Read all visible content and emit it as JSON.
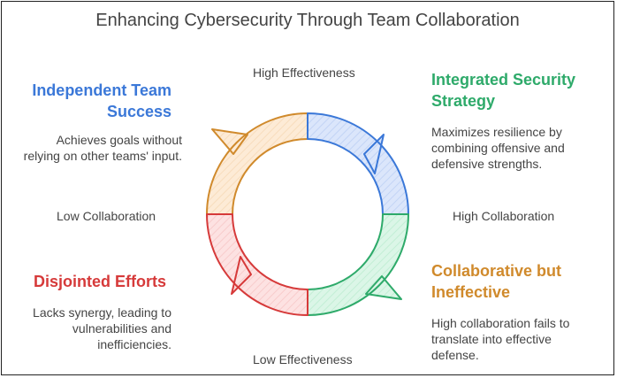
{
  "title": "Enhancing Cybersecurity Through Team Collaboration",
  "axes": {
    "top": "High Effectiveness",
    "bottom": "Low Effectiveness",
    "left": "Low Collaboration",
    "right": "High Collaboration"
  },
  "quadrants": {
    "top_left": {
      "title_line1": "Independent Team",
      "title_line2": "Success",
      "desc": [
        "Achieves goals without",
        "relying on other teams' input."
      ],
      "color": "#3b78d8"
    },
    "top_right": {
      "title_line1": "Integrated Security",
      "title_line2": "Strategy",
      "desc": [
        "Maximizes resilience by",
        "combining offensive and",
        "defensive strengths."
      ],
      "color": "#2eaa6a"
    },
    "bottom_left": {
      "title_line1": "Disjointed Efforts",
      "desc": [
        "Lacks synergy, leading to",
        "vulnerabilities and",
        "inefficiencies."
      ],
      "color": "#d63a3a"
    },
    "bottom_right": {
      "title_line1": "Collaborative but",
      "title_line2": "Ineffective",
      "desc": [
        "High collaboration fails to",
        "translate into effective",
        "defense."
      ],
      "color": "#d08a2c"
    }
  },
  "cycle_colors": {
    "top_left_fill": "#fde9d2",
    "top_left_stroke": "#d08a2c",
    "top_right_fill": "#dbe6fb",
    "top_right_stroke": "#3b78d8",
    "bottom_right_fill": "#d9f5e6",
    "bottom_right_stroke": "#2eaa6a",
    "bottom_left_fill": "#fde0e0",
    "bottom_left_stroke": "#d63a3a"
  }
}
